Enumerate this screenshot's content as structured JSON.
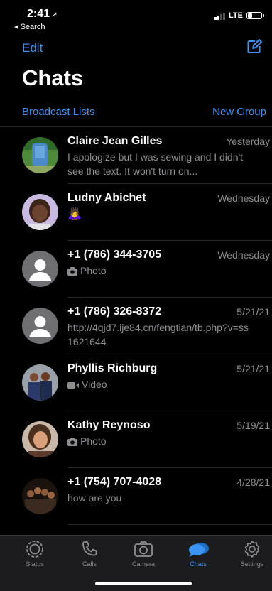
{
  "status_bar": {
    "time": "2:41",
    "back_label": "◂ Search",
    "network": "LTE",
    "battery_level": 0.35
  },
  "header": {
    "edit_label": "Edit",
    "title": "Chats",
    "broadcast_label": "Broadcast Lists",
    "new_group_label": "New Group"
  },
  "chats": [
    {
      "name": "Claire Jean Gilles",
      "date": "Yesterday",
      "preview": "I apologize but I was sewing and I didn't see the text. It won't turn on...",
      "preview_icon": "",
      "avatar": "photo-outdoor"
    },
    {
      "name": "Ludny Abichet",
      "date": "Wednesday",
      "preview": "🙇‍♀️",
      "preview_icon": "",
      "avatar": "photo-child"
    },
    {
      "name": "+1 (786) 344-3705",
      "date": "Wednesday",
      "preview": "Photo",
      "preview_icon": "camera-icon",
      "avatar": "default-person"
    },
    {
      "name": "+1 (786) 326-8372",
      "date": "5/21/21",
      "preview": "http://4qjd7.ije84.cn/fengtian/tb.php?v=ss1621644",
      "preview_icon": "",
      "avatar": "default-person"
    },
    {
      "name": "Phyllis Richburg",
      "date": "5/21/21",
      "preview": "Video",
      "preview_icon": "video-icon",
      "avatar": "photo-group"
    },
    {
      "name": "Kathy Reynoso",
      "date": "5/19/21",
      "preview": "Photo",
      "preview_icon": "camera-icon",
      "avatar": "photo-woman"
    },
    {
      "name": "+1 (754) 707-4028",
      "date": "4/28/21",
      "preview": "how are you",
      "preview_icon": "",
      "avatar": "photo-crowd"
    }
  ],
  "tabs": [
    {
      "label": "Status",
      "icon": "status-icon",
      "active": false
    },
    {
      "label": "Calls",
      "icon": "phone-icon",
      "active": false
    },
    {
      "label": "Camera",
      "icon": "camera-icon",
      "active": false
    },
    {
      "label": "Chats",
      "icon": "chat-bubbles-icon",
      "active": true
    },
    {
      "label": "Settings",
      "icon": "gear-icon",
      "active": false
    }
  ],
  "colors": {
    "accent": "#3a93f5",
    "background": "#000000",
    "secondary_text": "#8e8e93",
    "tab_bar": "#1c1c1e"
  }
}
